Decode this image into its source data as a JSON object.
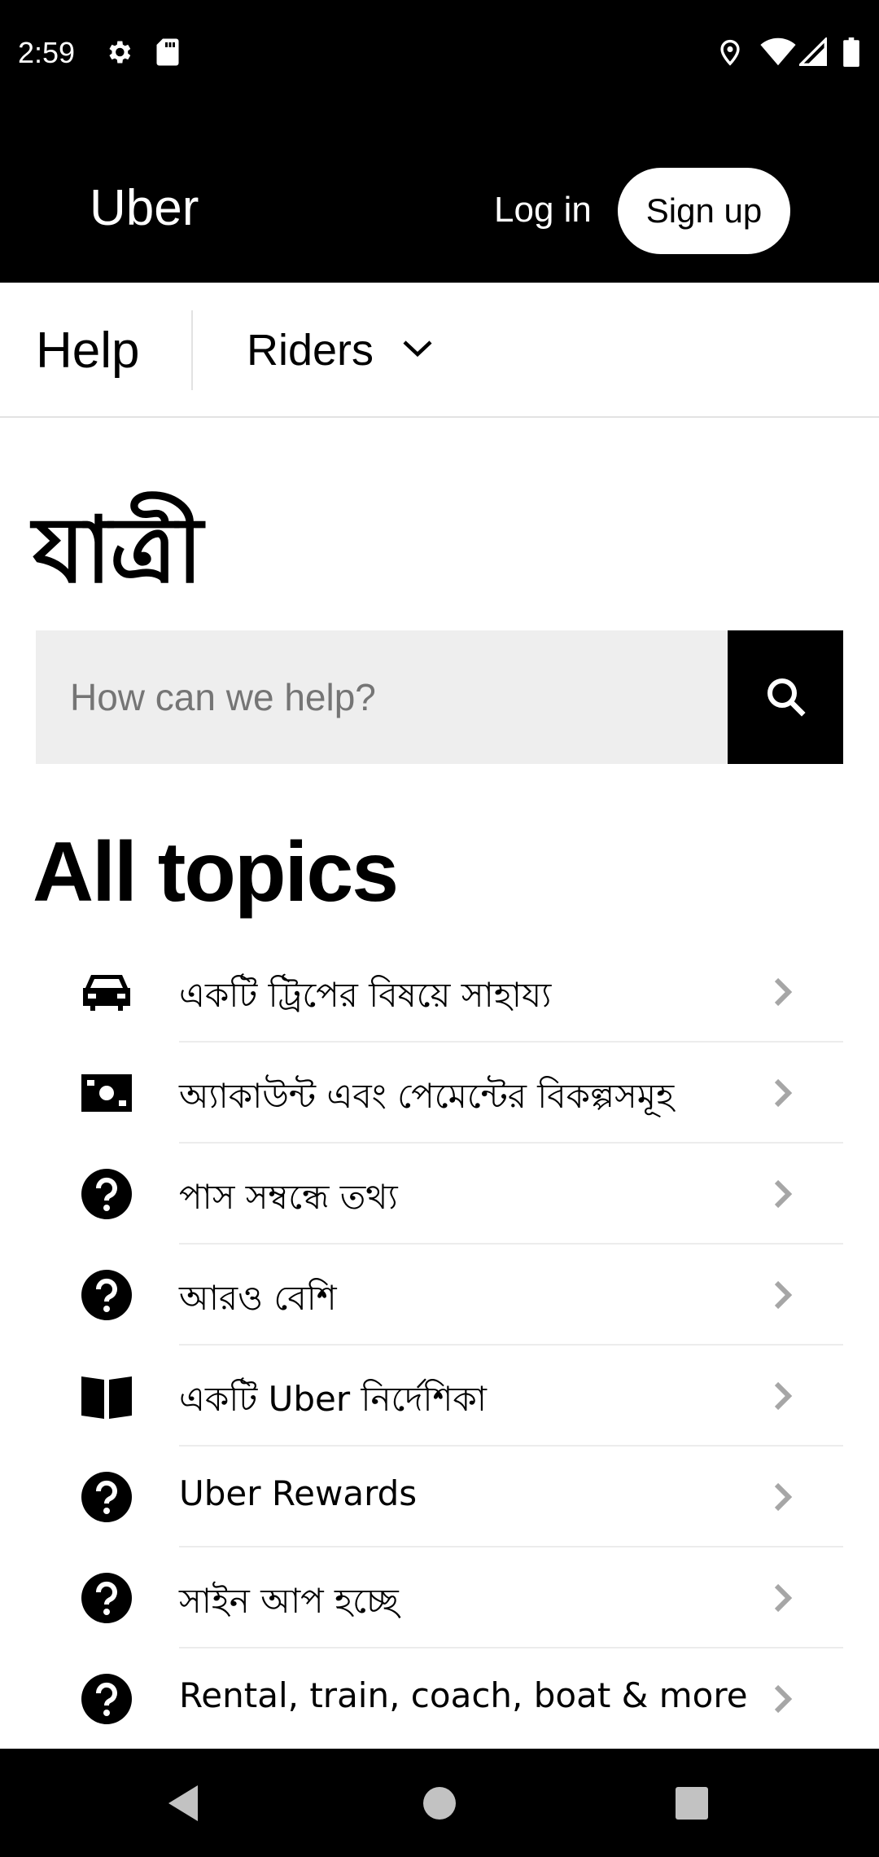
{
  "status_bar": {
    "time": "2:59",
    "icons": [
      "settings-icon",
      "sd-card-icon",
      "location-icon",
      "wifi-icon",
      "cell-signal-icon",
      "battery-icon"
    ]
  },
  "header": {
    "brand": "Uber",
    "login_label": "Log in",
    "signup_label": "Sign up"
  },
  "subnav": {
    "help_label": "Help",
    "riders_label": "Riders"
  },
  "page_title": "যাত্রী",
  "search": {
    "placeholder": "How can we help?"
  },
  "all_topics_title": "All topics",
  "topics": [
    {
      "label": "একটি ট্রিপের বিষয়ে সাহায্য",
      "icon": "car-icon"
    },
    {
      "label": "অ্যাকাউন্ট এবং পেমেন্টের বিকল্পসমূহ",
      "icon": "cash-icon"
    },
    {
      "label": "পাস সম্বন্ধে তথ্য",
      "icon": "help-circle-icon"
    },
    {
      "label": "আরও বেশি",
      "icon": "help-circle-icon"
    },
    {
      "label": "একটি Uber নির্দেশিকা",
      "icon": "book-icon"
    },
    {
      "label": "Uber Rewards",
      "icon": "help-circle-icon"
    },
    {
      "label": "সাইন আপ হচ্ছে",
      "icon": "help-circle-icon"
    },
    {
      "label": "Rental, train, coach, boat & more",
      "icon": "help-circle-icon"
    }
  ],
  "colors": {
    "header_bg": "#000000",
    "search_bg": "#eeeeee",
    "chevron": "#a6a6a6"
  }
}
